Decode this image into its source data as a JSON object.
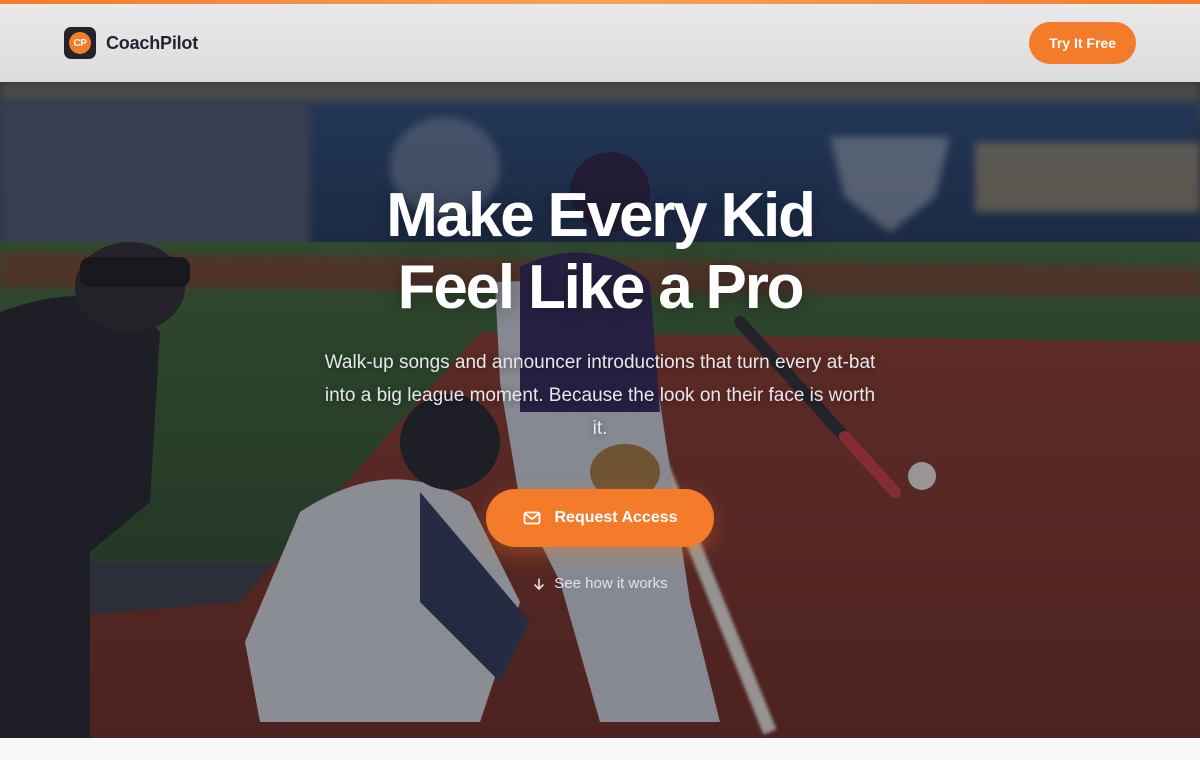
{
  "brand": {
    "name": "CoachPilot",
    "logo_initials": "CP"
  },
  "nav": {
    "cta_label": "Try It Free"
  },
  "hero": {
    "headline_line1": "Make Every Kid",
    "headline_line2": "Feel Like a Pro",
    "subtext": "Walk-up songs and announcer introductions that turn every at-bat into a big league moment. Because the look on their face is worth it.",
    "primary_cta": "Request Access",
    "secondary_link": "See how it works"
  },
  "colors": {
    "accent": "#f47b2a",
    "dark": "#23242b"
  },
  "icons": {
    "cta": "mail-icon",
    "secondary": "arrow-down-icon"
  }
}
